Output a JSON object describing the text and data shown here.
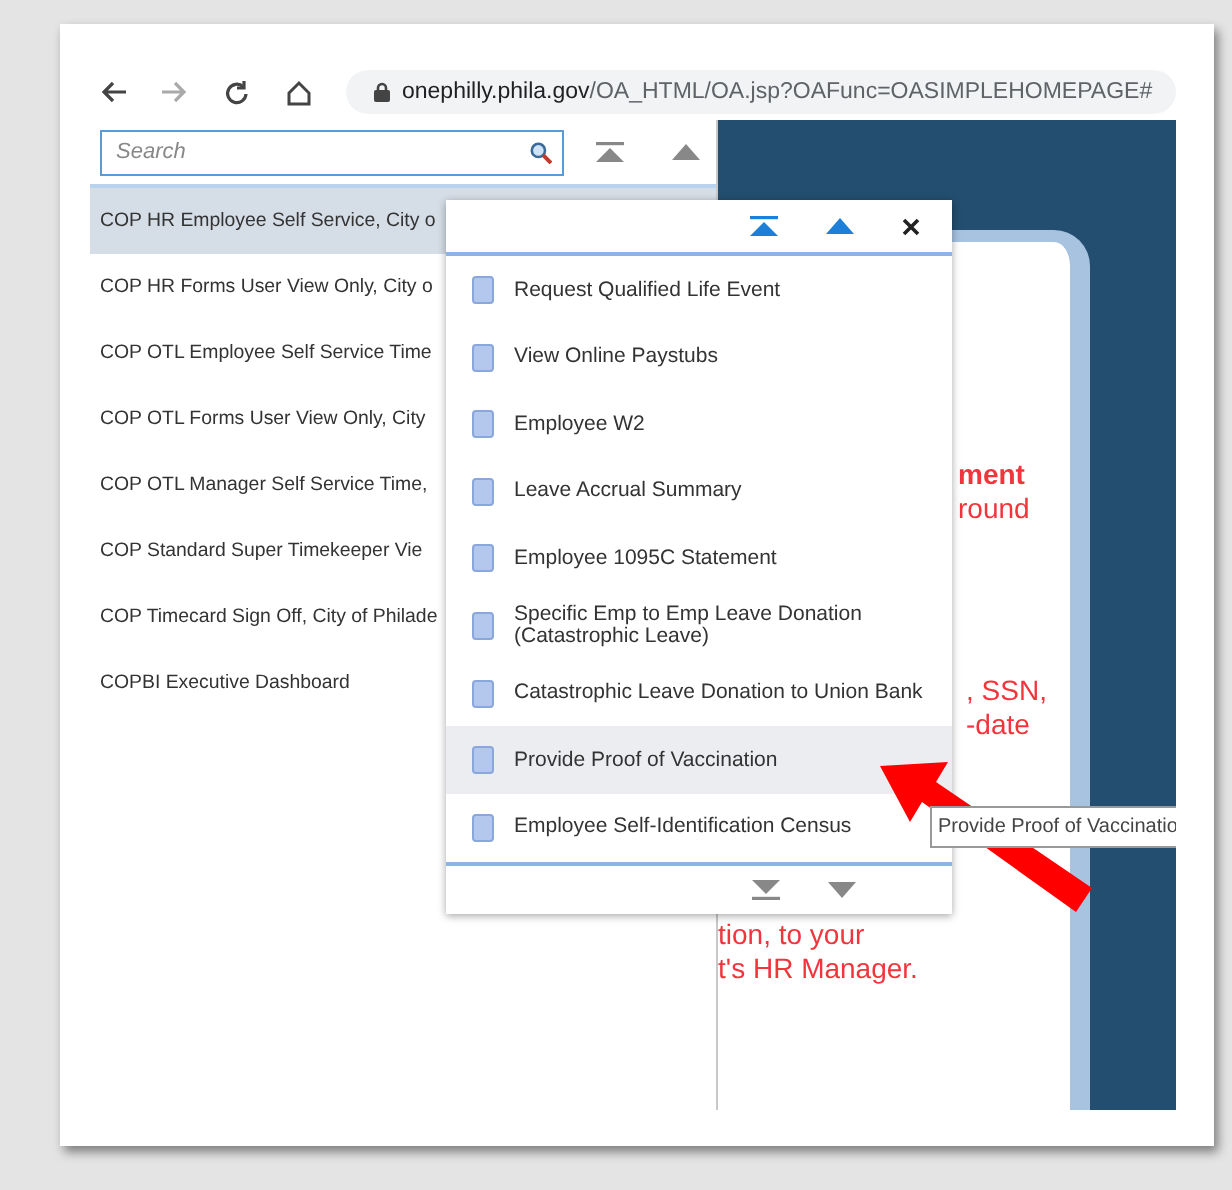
{
  "browser": {
    "url_host": "onephilly.phila.gov",
    "url_path": "/OA_HTML/OA.jsp?OAFunc=OASIMPLEHOMEPAGE#"
  },
  "search": {
    "placeholder": "Search"
  },
  "responsibilities": [
    {
      "label": "COP HR Employee Self Service, City o",
      "selected": true
    },
    {
      "label": "COP HR Forms User View Only, City o",
      "selected": false
    },
    {
      "label": "COP OTL Employee Self Service Time",
      "selected": false
    },
    {
      "label": "COP OTL Forms User View Only, City",
      "selected": false
    },
    {
      "label": "COP OTL Manager Self Service Time,",
      "selected": false
    },
    {
      "label": "COP Standard Super Timekeeper Vie",
      "selected": false
    },
    {
      "label": "COP Timecard Sign Off, City of Philade",
      "selected": false
    },
    {
      "label": "COPBI Executive Dashboard",
      "selected": false
    }
  ],
  "card_text": [
    [
      {
        "text": "ment",
        "bold": true
      },
      {
        "text": "round",
        "bold": false
      }
    ],
    [
      {
        "text": ", SSN,",
        "bold": false
      },
      {
        "text": "-date",
        "bold": false
      }
    ],
    [
      {
        "text": "tion, to your",
        "bold": false
      },
      {
        "text": "t's HR Manager.",
        "bold": false
      }
    ]
  ],
  "menu": {
    "items": [
      {
        "label": "Request Qualified Life Event",
        "selected": false
      },
      {
        "label": "View Online Paystubs",
        "selected": false
      },
      {
        "label": "Employee W2",
        "selected": false
      },
      {
        "label": "Leave Accrual Summary",
        "selected": false
      },
      {
        "label": "Employee 1095C Statement",
        "selected": false
      },
      {
        "label": "Specific Emp to Emp Leave Donation (Catastrophic Leave)",
        "selected": false
      },
      {
        "label": "Catastrophic Leave Donation to Union Bank",
        "selected": false
      },
      {
        "label": "Provide Proof of Vaccination",
        "selected": true
      },
      {
        "label": "Employee Self-Identification Census",
        "selected": false
      }
    ]
  },
  "tooltip": {
    "text": "Provide Proof of Vaccinatio"
  }
}
